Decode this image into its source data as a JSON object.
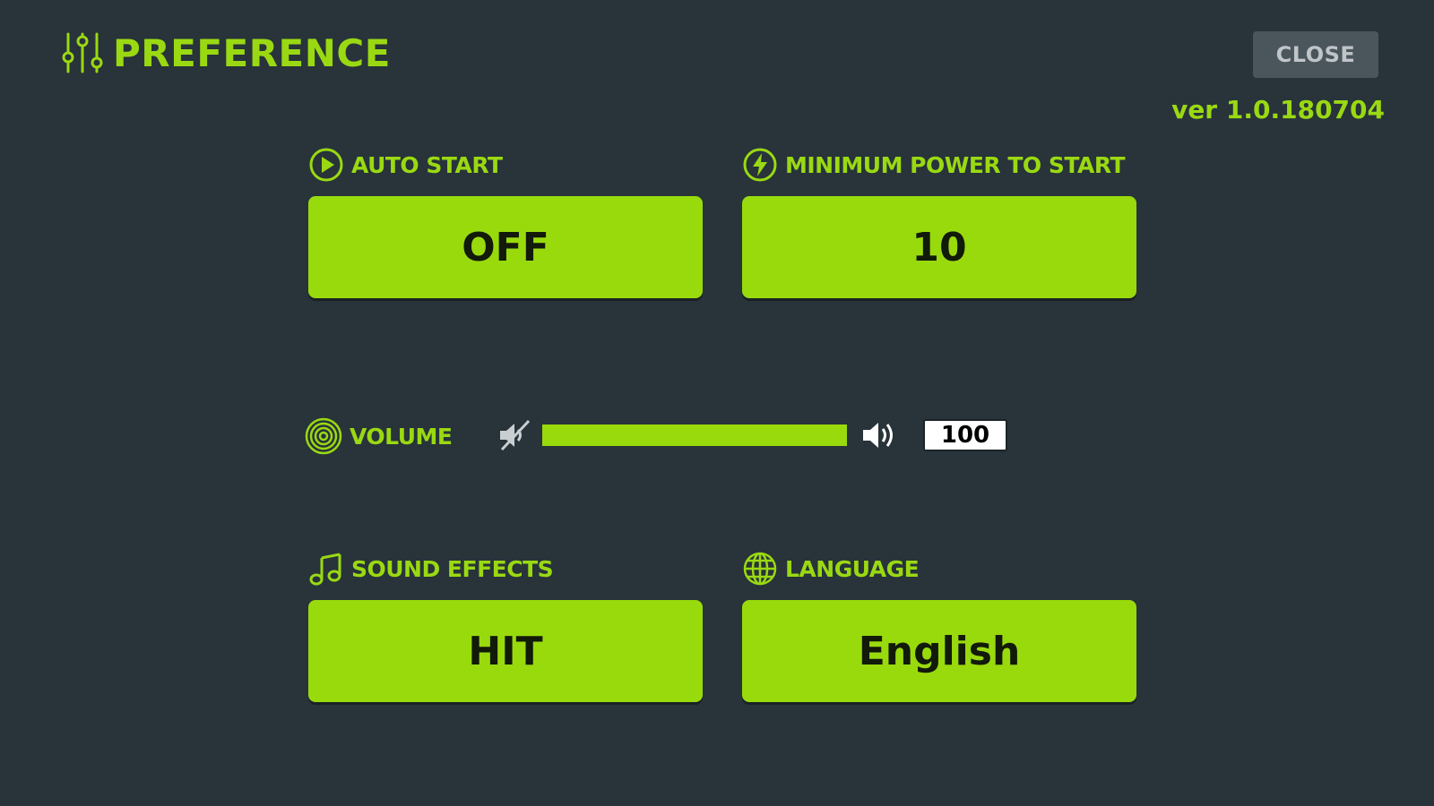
{
  "header": {
    "title": "PREFERENCE",
    "icon": "sliders-icon"
  },
  "close_label": "CLOSE",
  "version": "ver 1.0.180704",
  "auto_start": {
    "label": "AUTO START",
    "icon": "play-circle-icon",
    "value": "OFF"
  },
  "min_power": {
    "label": "MINIMUM POWER TO START",
    "icon": "power-bolt-icon",
    "value": "10"
  },
  "volume": {
    "label": "VOLUME",
    "icon": "volume-rings-icon",
    "value": "100",
    "level_percent": 100
  },
  "sound_effects": {
    "label": "SOUND EFFECTS",
    "icon": "music-note-icon",
    "value": "HIT"
  },
  "language": {
    "label": "LANGUAGE",
    "icon": "globe-icon",
    "value": "English"
  },
  "colors": {
    "accent": "#9ad912",
    "background": "#28333a",
    "close_bg": "#4b555c"
  }
}
